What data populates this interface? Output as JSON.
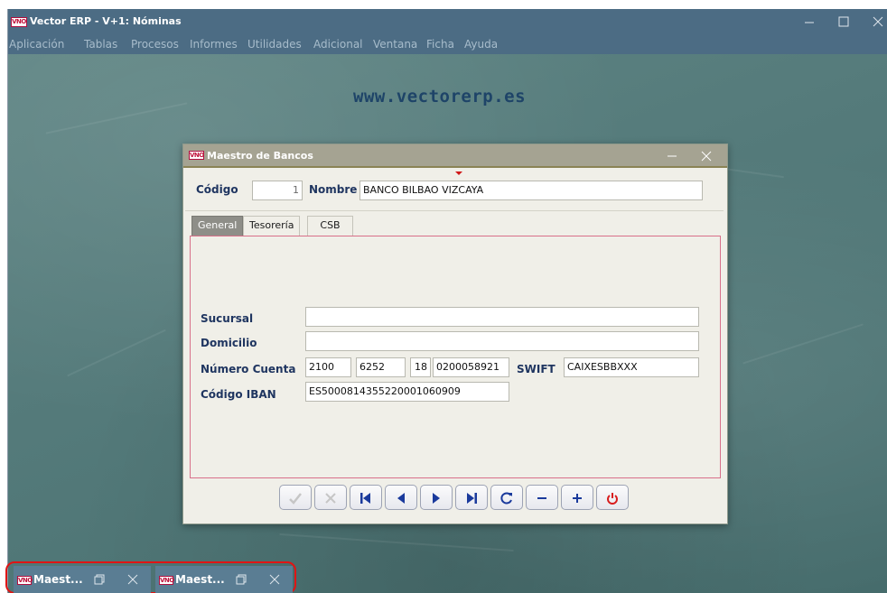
{
  "app": {
    "logo_text": "VNO",
    "title": "Vector ERP - V+1: Nóminas"
  },
  "menu": [
    "Aplicación",
    "Tablas",
    "Procesos",
    "Informes",
    "Utilidades",
    "Adicional",
    "Ventana",
    "Ficha",
    "Ayuda"
  ],
  "desktop": {
    "url": "www.vectorerp.es"
  },
  "dialog": {
    "logo_text": "VNO",
    "title": "Maestro de Bancos",
    "codigo": {
      "label": "Código",
      "value": "1"
    },
    "nombre": {
      "label": "Nombre",
      "value": "BANCO BILBAO VIZCAYA"
    },
    "tabs": [
      {
        "label": "General",
        "active": true
      },
      {
        "label": "Tesorería",
        "active": false
      },
      {
        "label": "CSB",
        "active": false
      }
    ],
    "sucursal": {
      "label": "Sucursal",
      "value": ""
    },
    "domicilio": {
      "label": "Domicilio",
      "value": ""
    },
    "numero_cuenta": {
      "label": "Número Cuenta",
      "entidad": "2100",
      "oficina": "6252",
      "dc": "18",
      "cuenta": "0200058921"
    },
    "swift": {
      "label": "SWIFT",
      "value": "CAIXESBBXXX"
    },
    "iban": {
      "label": "Código IBAN",
      "value": "ES5000814355220001060909"
    },
    "toolbar": [
      {
        "name": "accept-icon",
        "enabled": false
      },
      {
        "name": "cancel-icon",
        "enabled": false
      },
      {
        "name": "first-record-icon",
        "enabled": true
      },
      {
        "name": "previous-record-icon",
        "enabled": true
      },
      {
        "name": "next-record-icon",
        "enabled": true
      },
      {
        "name": "last-record-icon",
        "enabled": true
      },
      {
        "name": "refresh-icon",
        "enabled": true
      },
      {
        "name": "delete-record-icon",
        "enabled": true
      },
      {
        "name": "add-record-icon",
        "enabled": true
      },
      {
        "name": "power-close-icon",
        "enabled": true
      }
    ]
  },
  "taskbar": [
    {
      "logo_text": "VNO",
      "label": "Maest..."
    },
    {
      "logo_text": "VNO",
      "label": "Maest..."
    }
  ],
  "colors": {
    "titlebar": "#4c6c84",
    "label_blue": "#1f3560",
    "url_blue": "#1e4468",
    "desktop_green": "#557b7b",
    "dialog_bg": "#f0efe8",
    "panel_border": "#d8708a",
    "highlight_red": "#e01414"
  }
}
